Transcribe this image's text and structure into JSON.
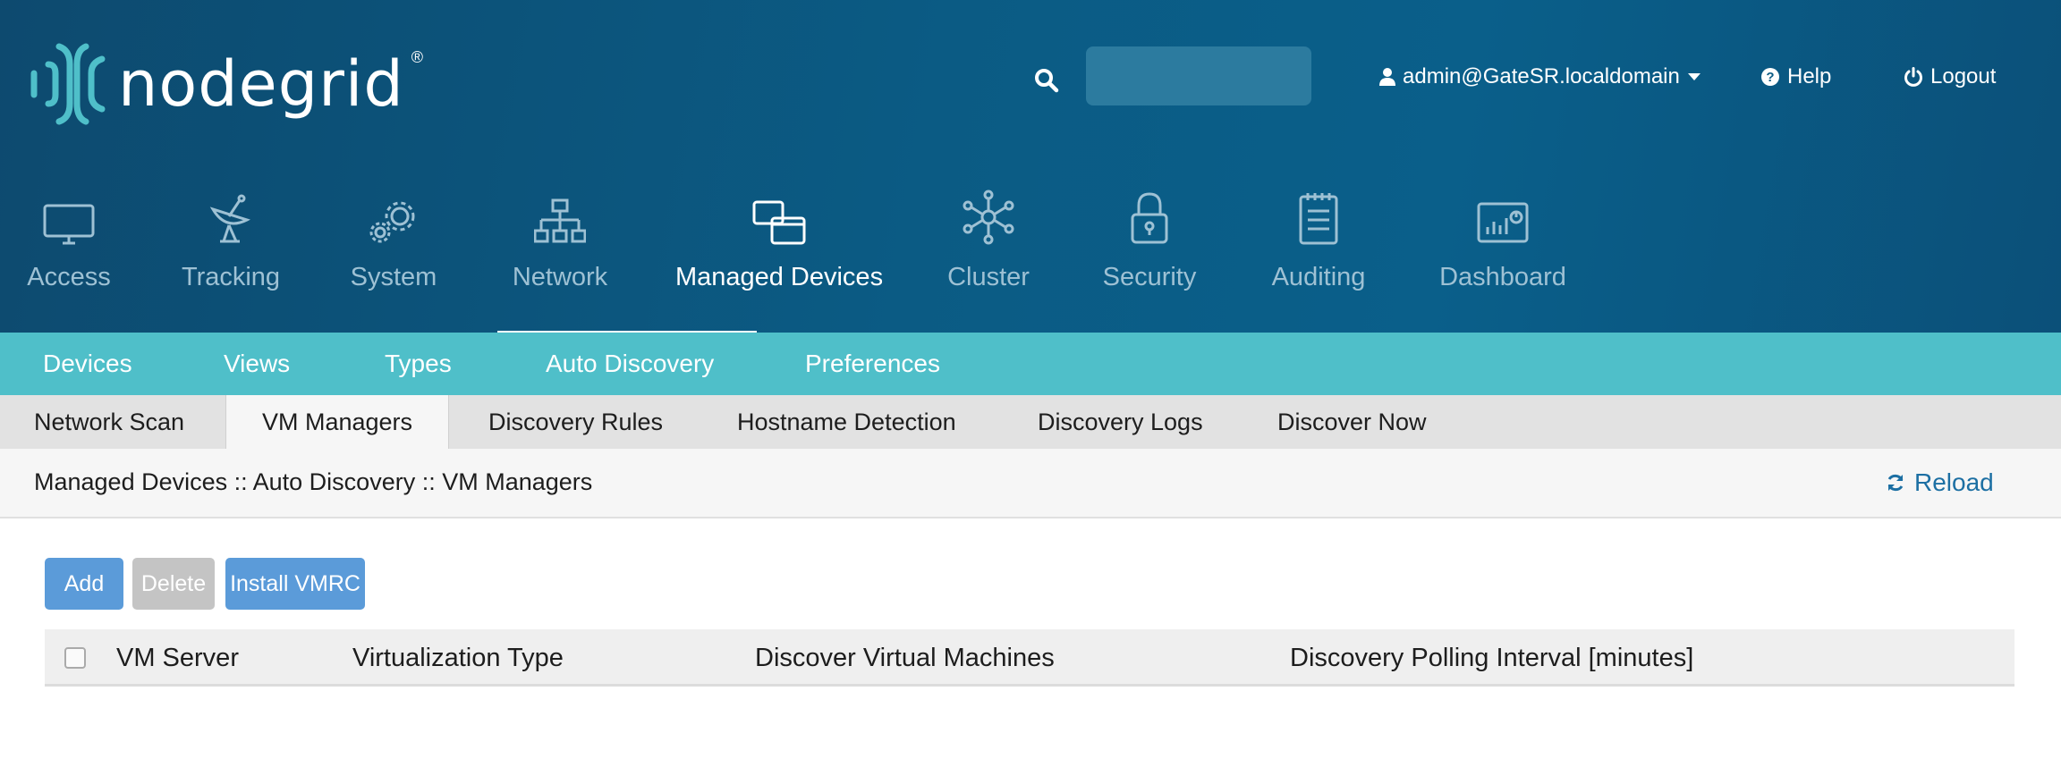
{
  "header": {
    "brand": "nodegrid",
    "brand_mark": "®",
    "search": {
      "placeholder": "",
      "value": ""
    },
    "user_label": "admin@GateSR.localdomain",
    "help_label": "Help",
    "logout_label": "Logout"
  },
  "main_nav": {
    "items": [
      {
        "label": "Access",
        "icon": "monitor-icon"
      },
      {
        "label": "Tracking",
        "icon": "satellite-dish-icon"
      },
      {
        "label": "System",
        "icon": "gears-icon"
      },
      {
        "label": "Network",
        "icon": "network-tree-icon"
      },
      {
        "label": "Managed Devices",
        "icon": "windows-icon",
        "active": true
      },
      {
        "label": "Cluster",
        "icon": "cluster-icon"
      },
      {
        "label": "Security",
        "icon": "lock-icon"
      },
      {
        "label": "Auditing",
        "icon": "notepad-icon"
      },
      {
        "label": "Dashboard",
        "icon": "dashboard-icon"
      }
    ]
  },
  "sub_nav": {
    "items": [
      "Devices",
      "Views",
      "Types",
      "Auto Discovery",
      "Preferences"
    ],
    "active": "Auto Discovery"
  },
  "tabs": {
    "items": [
      "Network Scan",
      "VM Managers",
      "Discovery Rules",
      "Hostname Detection",
      "Discovery Logs",
      "Discover Now"
    ],
    "active": "VM Managers"
  },
  "breadcrumb": "Managed Devices :: Auto Discovery :: VM Managers",
  "reload_label": "Reload",
  "toolbar": {
    "add_label": "Add",
    "delete_label": "Delete",
    "install_label": "Install VMRC"
  },
  "table": {
    "columns": [
      "VM Server",
      "Virtualization Type",
      "Discover Virtual Machines",
      "Discovery Polling Interval [minutes]"
    ],
    "rows": []
  },
  "colors": {
    "header_bg": "#0b5b84",
    "subnav_bg": "#4fbfc9",
    "button_primary": "#5b9bd9",
    "button_disabled": "#c4c4c4",
    "link": "#1c6fa3"
  }
}
